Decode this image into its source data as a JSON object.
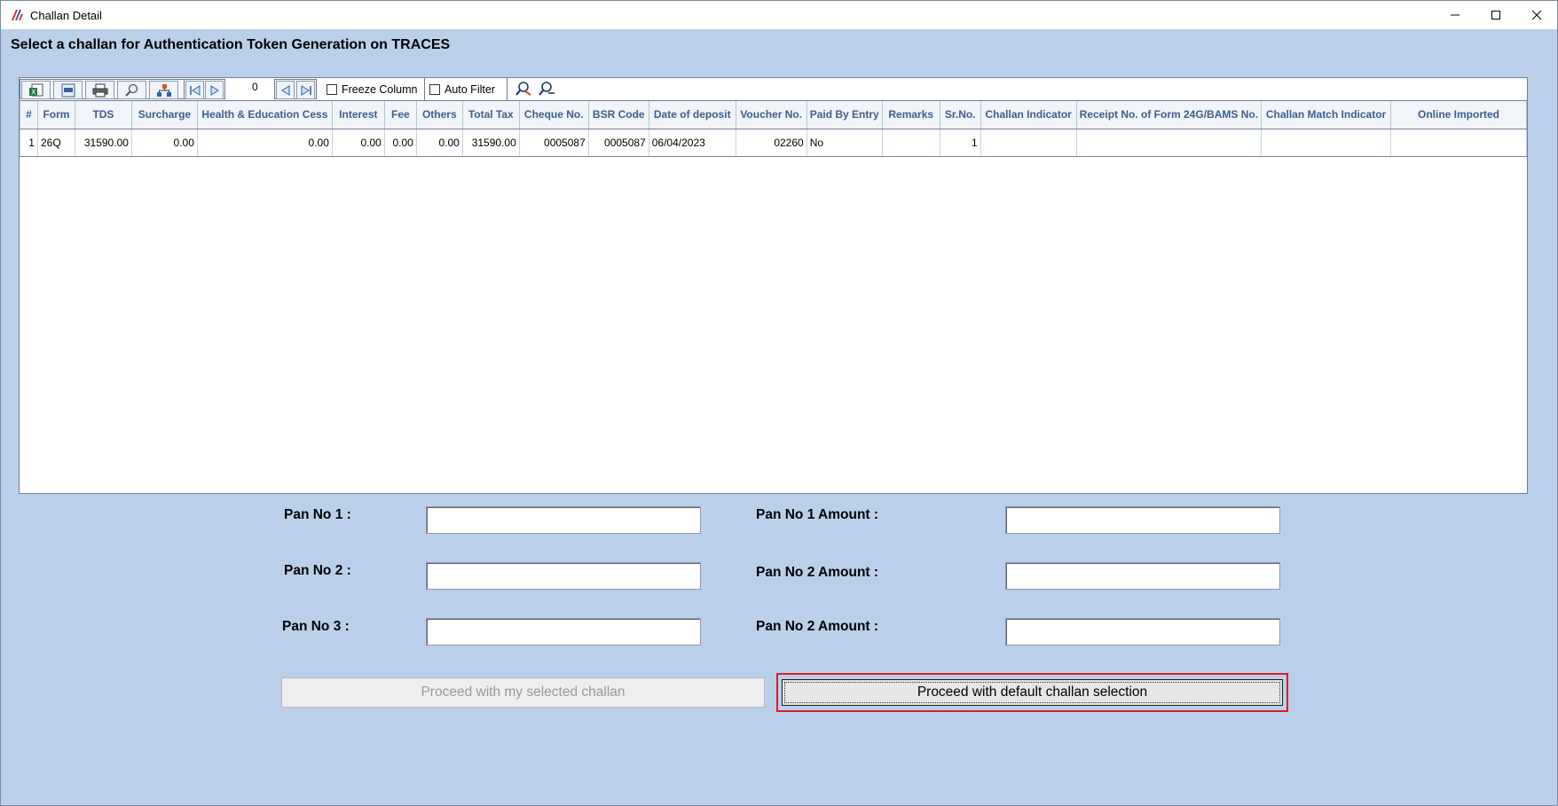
{
  "window": {
    "title": "Challan Detail"
  },
  "heading": "Select a challan for Authentication Token Generation on TRACES",
  "toolbar": {
    "page_number": "0",
    "freeze_column_label": "Freeze Column",
    "auto_filter_label": "Auto Filter"
  },
  "table": {
    "headers": [
      "#",
      "Form",
      "TDS",
      "Surcharge",
      "Health & Education Cess",
      "Interest",
      "Fee",
      "Others",
      "Total Tax",
      "Cheque No.",
      "BSR Code",
      "Date of deposit",
      "Voucher No.",
      "Paid By Entry",
      "Remarks",
      "Sr.No.",
      "Challan Indicator",
      "Receipt No. of Form 24G/BAMS No.",
      "Challan Match Indicator",
      "Online Imported"
    ],
    "rows": [
      [
        "1",
        "26Q",
        "31590.00",
        "0.00",
        "0.00",
        "0.00",
        "0.00",
        "0.00",
        "31590.00",
        "0005087",
        "0005087",
        "06/04/2023",
        "02260",
        "No",
        "",
        "1",
        "",
        "",
        "",
        ""
      ]
    ]
  },
  "form": {
    "pan1_label": "Pan No 1 :",
    "pan2_label": "Pan No 2 :",
    "pan3_label": "Pan No 3 :",
    "pan1_amount_label": "Pan No 1 Amount :",
    "pan2_amount_label": "Pan No 2 Amount :",
    "pan3_amount_label": "Pan No 2 Amount :",
    "pan1_value": "",
    "pan2_value": "",
    "pan3_value": "",
    "pan1_amount_value": "",
    "pan2_amount_value": "",
    "pan3_amount_value": ""
  },
  "buttons": {
    "proceed_selected": "Proceed with my selected challan",
    "proceed_default": "Proceed with default challan selection"
  },
  "colors": {
    "window_background": "#bad0ea",
    "header_text": "#3c5f8f",
    "highlight_border": "#d61f26"
  }
}
